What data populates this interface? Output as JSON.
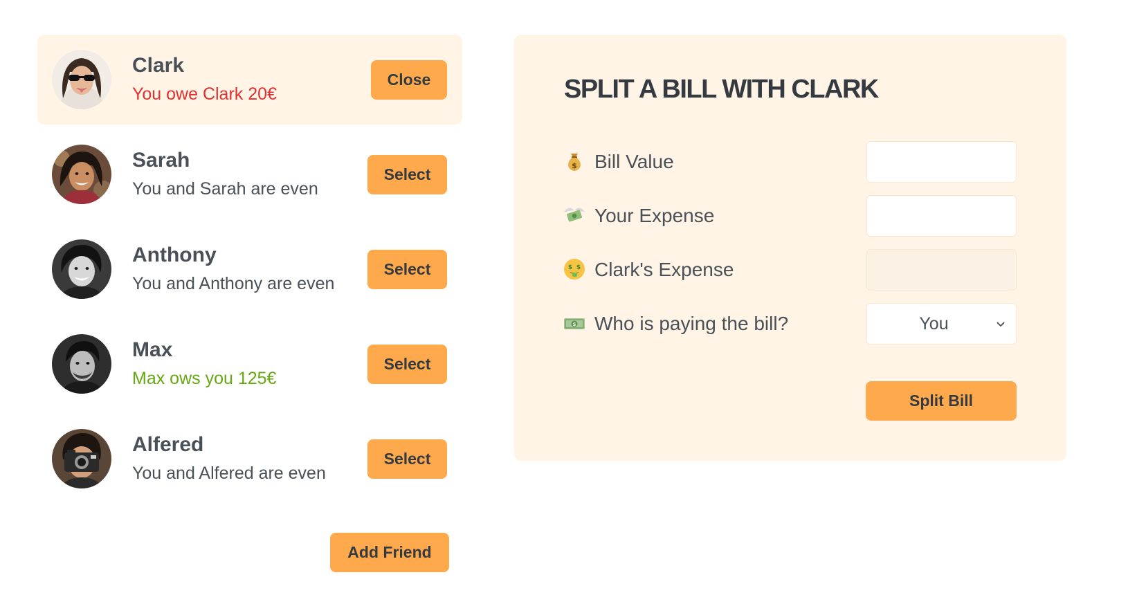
{
  "friends": [
    {
      "name": "Clark",
      "status": "You owe Clark 20€",
      "status_tone": "red",
      "button": "Close",
      "selected": true
    },
    {
      "name": "Sarah",
      "status": "You and Sarah are even",
      "status_tone": "neutral",
      "button": "Select",
      "selected": false
    },
    {
      "name": "Anthony",
      "status": "You and Anthony are even",
      "status_tone": "neutral",
      "button": "Select",
      "selected": false
    },
    {
      "name": "Max",
      "status": "Max ows you 125€",
      "status_tone": "green",
      "button": "Select",
      "selected": false
    },
    {
      "name": "Alfered",
      "status": "You and Alfered are even",
      "status_tone": "neutral",
      "button": "Select",
      "selected": false
    }
  ],
  "add_friend_label": "Add Friend",
  "split_form": {
    "title": "SPLIT A BILL WITH CLARK",
    "bill_value": {
      "icon": "money-bag-icon",
      "label": "Bill Value",
      "value": ""
    },
    "your_expense": {
      "icon": "money-with-wings-icon",
      "label": "Your Expense",
      "value": ""
    },
    "friend_expense": {
      "icon": "money-mouth-face-icon",
      "label": "Clark's Expense",
      "value": ""
    },
    "payer": {
      "icon": "dollar-banknote-icon",
      "label": "Who is paying the bill?",
      "selected": "You"
    },
    "submit_label": "Split Bill"
  },
  "colors": {
    "accent": "#ffa94d",
    "panel": "#fff4e6",
    "text": "#495057",
    "owe": "#e03131",
    "owed": "#66a80f"
  }
}
